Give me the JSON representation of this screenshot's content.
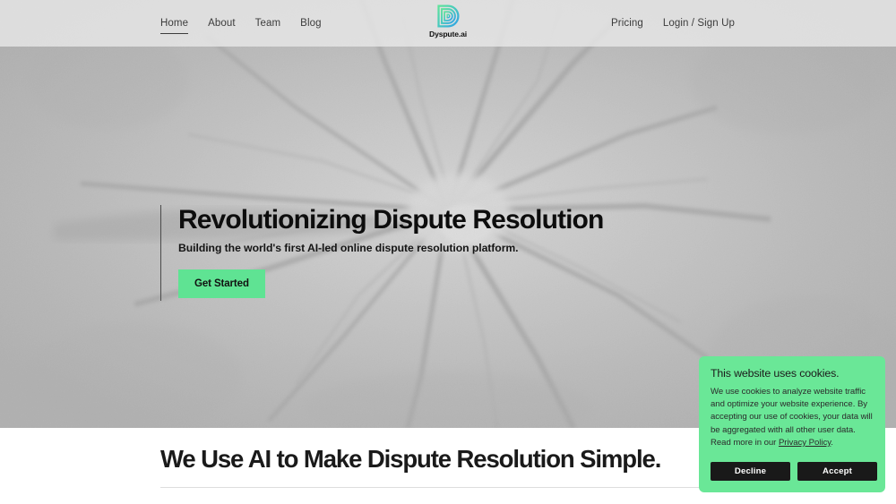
{
  "brand": {
    "logo_text": "Dyspute.ai",
    "logo_icon": "dyspute-d-logo-icon",
    "gradient_start": "#5fe39a",
    "gradient_end": "#2f9fe8"
  },
  "header": {
    "nav_left": [
      {
        "label": "Home",
        "active": true
      },
      {
        "label": "About",
        "active": false
      },
      {
        "label": "Team",
        "active": false
      },
      {
        "label": "Blog",
        "active": false
      }
    ],
    "nav_right": [
      {
        "label": "Pricing"
      },
      {
        "label": "Login / Sign Up"
      }
    ]
  },
  "hero": {
    "title": "Revolutionizing Dispute Resolution",
    "subtitle": "Building the world's first AI-led online dispute resolution platform.",
    "cta_label": "Get Started",
    "cta_color": "#5fe393"
  },
  "section": {
    "heading": "We Use AI to Make Dispute Resolution Simple."
  },
  "cookie_banner": {
    "title": "This website uses cookies.",
    "body_before_link": "We use cookies to analyze website traffic and optimize your website experience. By accepting our use of cookies, your data will be aggregated with all other user data. Read more in our ",
    "link_label": "Privacy Policy",
    "body_after_link": ".",
    "decline_label": "Decline",
    "accept_label": "Accept",
    "background_color": "#6ae797",
    "button_color": "#191919"
  }
}
